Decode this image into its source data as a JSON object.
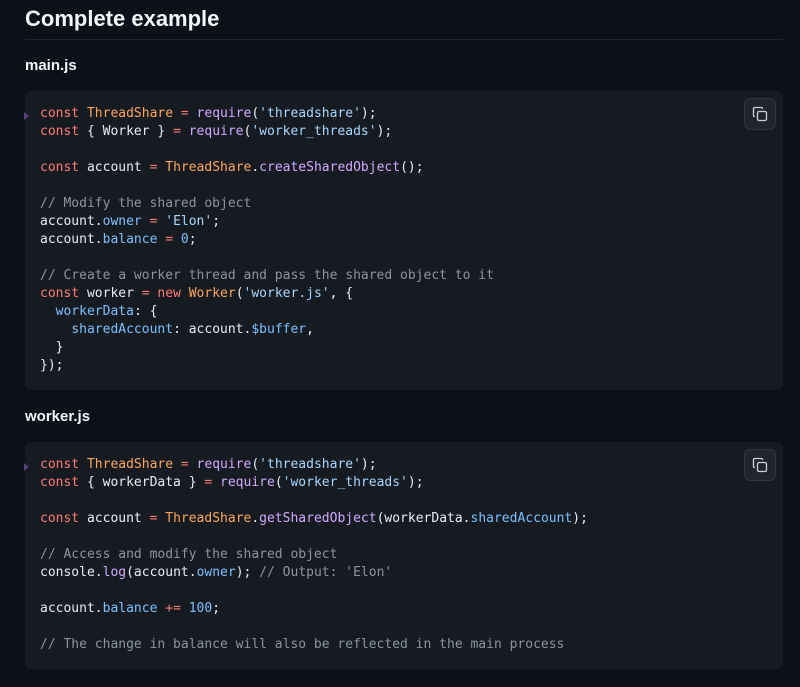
{
  "heading": "Complete example",
  "icons": {
    "copy": "copy-icon"
  },
  "colors": {
    "background": "#0d1117",
    "code_bg": "#161b22"
  },
  "blocks": [
    {
      "file_title": "main.js",
      "lines": [
        [
          [
            "kw",
            "const "
          ],
          [
            "cls",
            "ThreadShare"
          ],
          [
            "op",
            " = "
          ],
          [
            "fn",
            "require"
          ],
          [
            "",
            "("
          ],
          [
            "str",
            "'threadshare'"
          ],
          [
            "",
            ");"
          ]
        ],
        [
          [
            "kw",
            "const "
          ],
          [
            "",
            "{ Worker } "
          ],
          [
            "op",
            "= "
          ],
          [
            "fn",
            "require"
          ],
          [
            "",
            "("
          ],
          [
            "str",
            "'worker_threads'"
          ],
          [
            "",
            ");"
          ]
        ],
        [],
        [
          [
            "kw",
            "const "
          ],
          [
            "",
            "account "
          ],
          [
            "op",
            "= "
          ],
          [
            "cls",
            "ThreadShare"
          ],
          [
            "",
            "."
          ],
          [
            "fn",
            "createSharedObject"
          ],
          [
            "",
            "();"
          ]
        ],
        [],
        [
          [
            "cmt",
            "// Modify the shared object"
          ]
        ],
        [
          [
            "",
            "account."
          ],
          [
            "prop",
            "owner"
          ],
          [
            "op",
            " = "
          ],
          [
            "str",
            "'Elon'"
          ],
          [
            "",
            ";"
          ]
        ],
        [
          [
            "",
            "account."
          ],
          [
            "prop",
            "balance"
          ],
          [
            "op",
            " = "
          ],
          [
            "num",
            "0"
          ],
          [
            "",
            ";"
          ]
        ],
        [],
        [
          [
            "cmt",
            "// Create a worker thread and pass the shared object to it"
          ]
        ],
        [
          [
            "kw",
            "const "
          ],
          [
            "",
            "worker "
          ],
          [
            "op",
            "= "
          ],
          [
            "kw",
            "new "
          ],
          [
            "cls",
            "Worker"
          ],
          [
            "",
            "("
          ],
          [
            "str",
            "'worker.js'"
          ],
          [
            "",
            ", {"
          ]
        ],
        [
          [
            "",
            "  "
          ],
          [
            "prop",
            "workerData"
          ],
          [
            "",
            ": {"
          ]
        ],
        [
          [
            "",
            "    "
          ],
          [
            "prop",
            "sharedAccount"
          ],
          [
            "",
            ": account."
          ],
          [
            "prop",
            "$buffer"
          ],
          [
            "",
            ","
          ]
        ],
        [
          [
            "",
            "  }"
          ]
        ],
        [
          [
            "",
            "});"
          ]
        ]
      ]
    },
    {
      "file_title": "worker.js",
      "lines": [
        [
          [
            "kw",
            "const "
          ],
          [
            "cls",
            "ThreadShare"
          ],
          [
            "op",
            " = "
          ],
          [
            "fn",
            "require"
          ],
          [
            "",
            "("
          ],
          [
            "str",
            "'threadshare'"
          ],
          [
            "",
            ");"
          ]
        ],
        [
          [
            "kw",
            "const "
          ],
          [
            "",
            "{ workerData } "
          ],
          [
            "op",
            "= "
          ],
          [
            "fn",
            "require"
          ],
          [
            "",
            "("
          ],
          [
            "str",
            "'worker_threads'"
          ],
          [
            "",
            ");"
          ]
        ],
        [],
        [
          [
            "kw",
            "const "
          ],
          [
            "",
            "account "
          ],
          [
            "op",
            "= "
          ],
          [
            "cls",
            "ThreadShare"
          ],
          [
            "",
            "."
          ],
          [
            "fn",
            "getSharedObject"
          ],
          [
            "",
            "(workerData."
          ],
          [
            "prop",
            "sharedAccount"
          ],
          [
            "",
            ");"
          ]
        ],
        [],
        [
          [
            "cmt",
            "// Access and modify the shared object"
          ]
        ],
        [
          [
            "",
            "console."
          ],
          [
            "fn",
            "log"
          ],
          [
            "",
            "(account."
          ],
          [
            "prop",
            "owner"
          ],
          [
            "",
            "); "
          ],
          [
            "cmt",
            "// Output: 'Elon'"
          ]
        ],
        [],
        [
          [
            "",
            "account."
          ],
          [
            "prop",
            "balance"
          ],
          [
            "op",
            " += "
          ],
          [
            "num",
            "100"
          ],
          [
            "",
            ";"
          ]
        ],
        [],
        [
          [
            "cmt",
            "// The change in balance will also be reflected in the main process"
          ]
        ]
      ]
    }
  ]
}
